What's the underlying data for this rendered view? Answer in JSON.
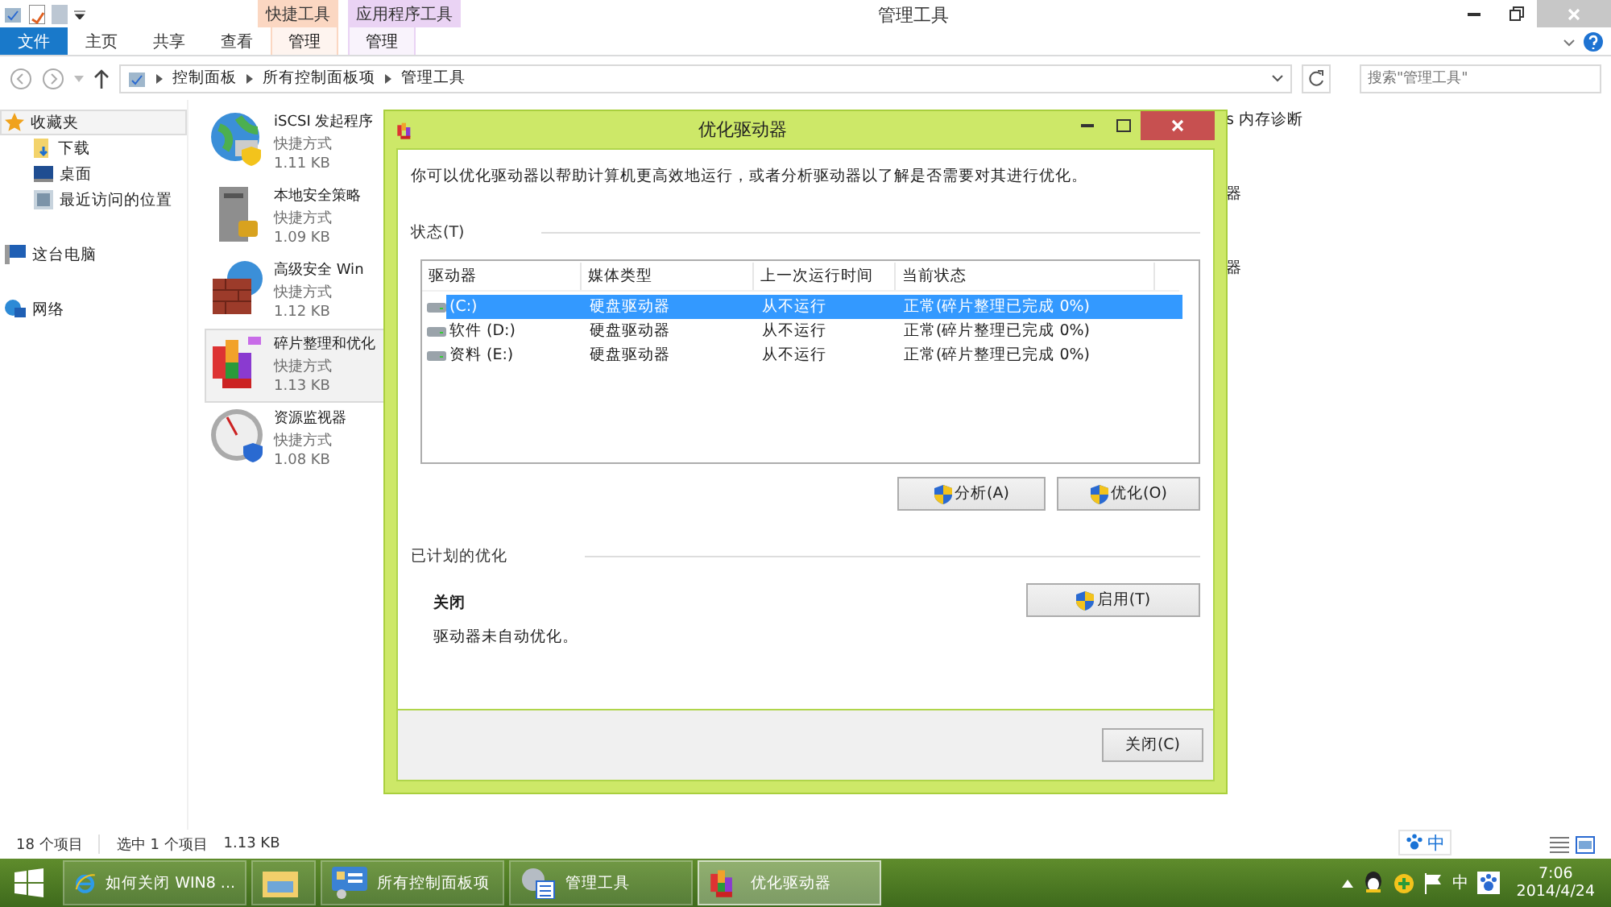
{
  "window": {
    "title": "管理工具"
  },
  "ribbon": {
    "context_groups": [
      {
        "label": "快捷工具",
        "color": "#fbd7c2",
        "tab": "管理"
      },
      {
        "label": "应用程序工具",
        "color": "#ead3f4",
        "tab": "管理"
      }
    ],
    "tabs": [
      {
        "label": "文件",
        "selected": true
      },
      {
        "label": "主页",
        "selected": false
      },
      {
        "label": "共享",
        "selected": false
      },
      {
        "label": "查看",
        "selected": false
      }
    ]
  },
  "address_bar": {
    "path": [
      "控制面板",
      "所有控制面板项",
      "管理工具"
    ],
    "search": {
      "placeholder": "搜索\"管理工具\""
    }
  },
  "sidebar": {
    "items": [
      {
        "label": "收藏夹",
        "selected": true,
        "children": [
          {
            "label": "下载",
            "selected": false
          },
          {
            "label": "桌面",
            "selected": false
          },
          {
            "label": "最近访问的位置",
            "selected": false
          }
        ]
      },
      {
        "label": "这台电脑",
        "selected": false
      },
      {
        "label": "网络",
        "selected": false
      }
    ]
  },
  "files": [
    {
      "name": "iSCSI 发起程序",
      "type": "快捷方式",
      "size": "1.11 KB",
      "selected": false
    },
    {
      "name": "本地安全策略",
      "type": "快捷方式",
      "size": "1.09 KB",
      "selected": false
    },
    {
      "name": "高级安全 Win",
      "type": "快捷方式",
      "size": "1.12 KB",
      "selected": false
    },
    {
      "name": "碎片整理和优化",
      "type": "快捷方式",
      "size": "1.13 KB",
      "selected": true
    },
    {
      "name": "资源监视器",
      "type": "快捷方式",
      "size": "1.08 KB",
      "selected": false
    }
  ],
  "files_column_2": [
    "s 内存诊断",
    "器",
    "器"
  ],
  "status_bar": {
    "count": "18 个项目",
    "selection": "选中 1 个项目",
    "size": "1.13 KB"
  },
  "dialog": {
    "title": "优化驱动器",
    "description": "你可以优化驱动器以帮助计算机更高效地运行，或者分析驱动器以了解是否需要对其进行优化。",
    "status_section": "状态(T)",
    "columns": [
      "驱动器",
      "媒体类型",
      "上一次运行时间",
      "当前状态"
    ],
    "drives": [
      {
        "name": "(C:)",
        "media": "硬盘驱动器",
        "last_run": "从不运行",
        "status": "正常(碎片整理已完成 0%)",
        "selected": true
      },
      {
        "name": "软件 (D:)",
        "media": "硬盘驱动器",
        "last_run": "从不运行",
        "status": "正常(碎片整理已完成 0%)",
        "selected": false
      },
      {
        "name": "资料 (E:)",
        "media": "硬盘驱动器",
        "last_run": "从不运行",
        "status": "正常(碎片整理已完成 0%)",
        "selected": false
      }
    ],
    "actions": [
      "分析(A)",
      "优化(O)"
    ],
    "schedule_section": "已计划的优化",
    "schedule_state": "关闭",
    "schedule_note": "驱动器未自动优化。",
    "schedule_button": "启用(T)",
    "close_button": "关闭(C)"
  },
  "ime_bar": {
    "label": "中"
  },
  "taskbar": {
    "items": [
      {
        "label": "如何关闭 WIN8 ...",
        "selected": false
      },
      {
        "selected": false
      },
      {
        "label": "所有控制面板项",
        "selected": false
      },
      {
        "label": "管理工具",
        "selected": false
      },
      {
        "label": "优化驱动器",
        "selected": true
      }
    ],
    "tray": {
      "ime": "中",
      "time": "7:06",
      "date": "2014/4/24"
    }
  }
}
